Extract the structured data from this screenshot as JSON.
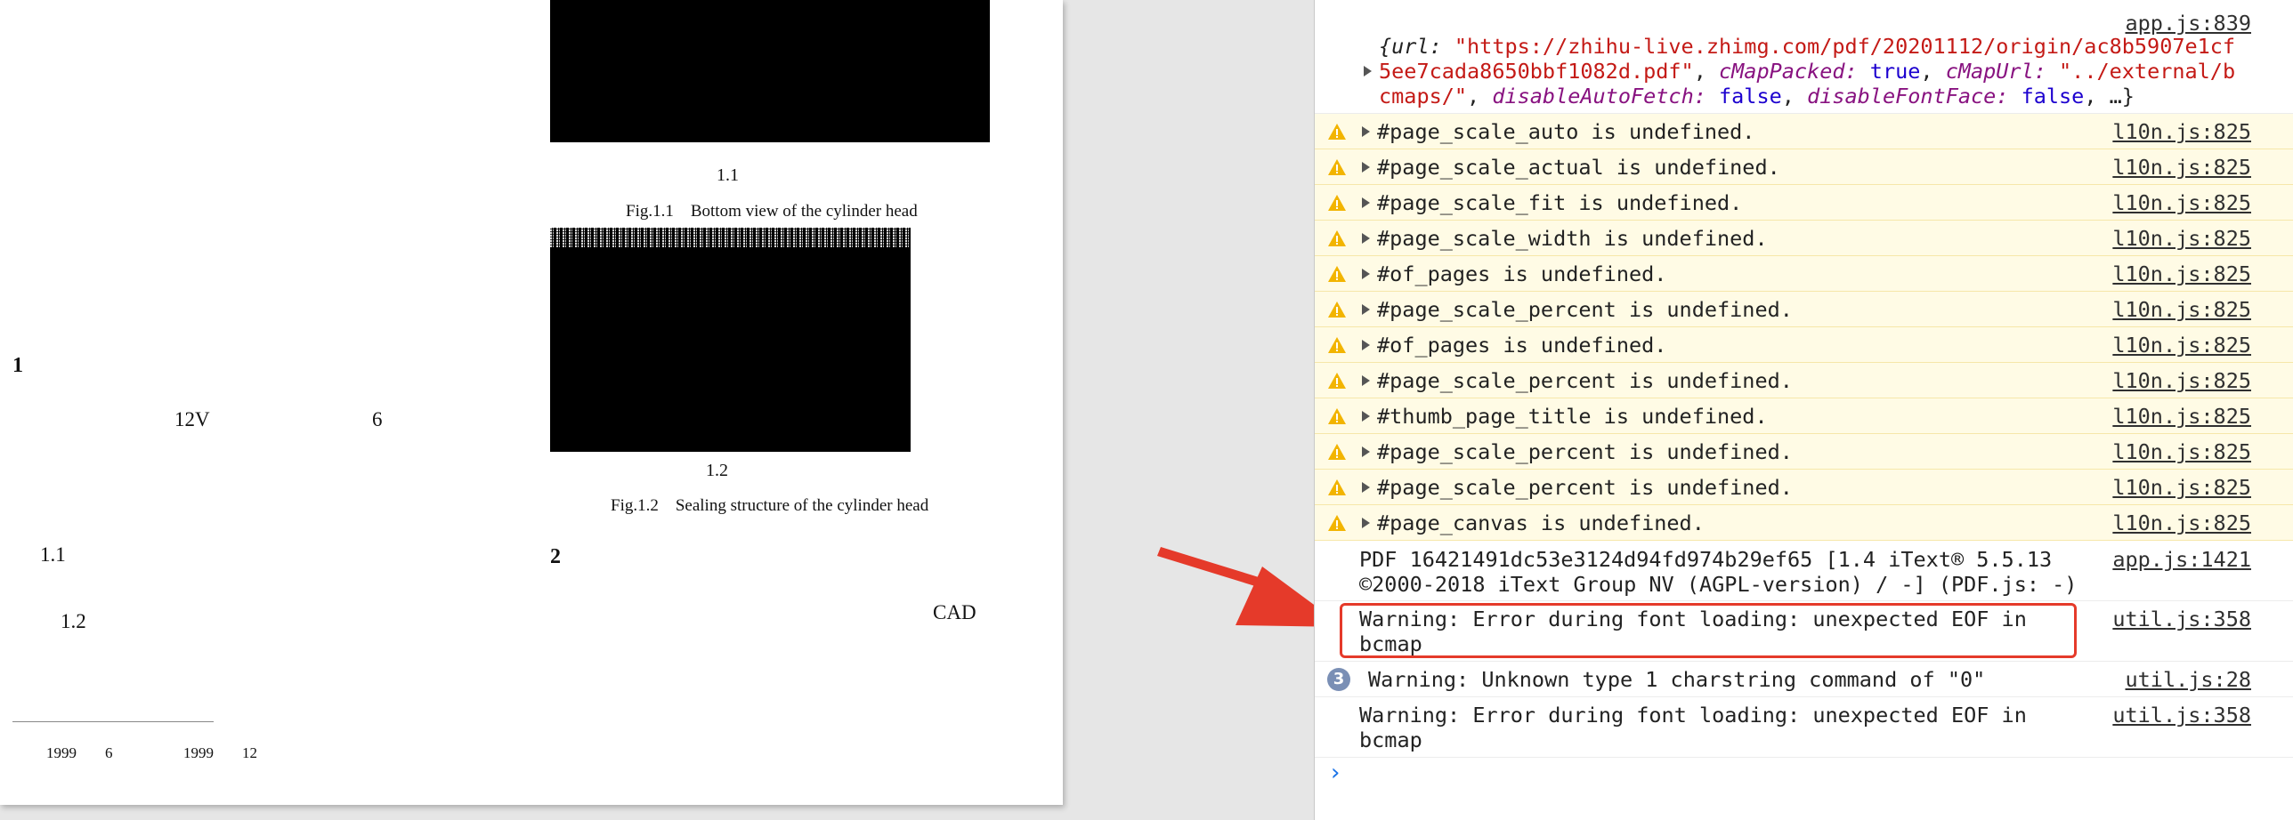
{
  "pdf": {
    "section_number": "1",
    "text_12v": "12V",
    "text_6": "6",
    "text_1_1": "1.1",
    "text_1_2": "1.2",
    "section_number_2": "2",
    "text_cad": "CAD",
    "fig1_number": "1.1",
    "fig1_caption": "Fig.1.1　Bottom view of the cylinder head",
    "fig2_number": "1.2",
    "fig2_caption": "Fig.1.2　Sealing structure of the cylinder head",
    "footnote_year1": "1999",
    "footnote_month1": "6",
    "footnote_year2": "1999",
    "footnote_month2": "12"
  },
  "console": {
    "first_source": "app.js:839",
    "first_line1_prefix": "{url: ",
    "first_line1_url": "\"https://zhihu-live.zhimg.com/pdf/20201112/origin/ac8b5907e1cf",
    "first_line2_url": "5ee7cada8650bbf1082d.pdf\"",
    "first_line2_cmap_key": "cMapPacked: ",
    "first_line2_cmap_val": "true",
    "first_line2_cmapurl_key": "cMapUrl: ",
    "first_line2_cmapurl_val": "\"../external/b",
    "first_line3_val": "cmaps/\"",
    "first_line3_daf_key": "disableAutoFetch: ",
    "first_line3_daf_val": "false",
    "first_line3_dff_key": "disableFontFace: ",
    "first_line3_dff_val": "false",
    "first_line3_tail": ", …}",
    "warnings": [
      {
        "text": "#page_scale_auto is undefined.",
        "source": "l10n.js:825"
      },
      {
        "text": "#page_scale_actual is undefined.",
        "source": "l10n.js:825"
      },
      {
        "text": "#page_scale_fit is undefined.",
        "source": "l10n.js:825"
      },
      {
        "text": "#page_scale_width is undefined.",
        "source": "l10n.js:825"
      },
      {
        "text": "#of_pages is undefined.",
        "source": "l10n.js:825"
      },
      {
        "text": "#page_scale_percent is undefined.",
        "source": "l10n.js:825"
      },
      {
        "text": "#of_pages is undefined.",
        "source": "l10n.js:825"
      },
      {
        "text": "#page_scale_percent is undefined.",
        "source": "l10n.js:825"
      },
      {
        "text": "#thumb_page_title is undefined.",
        "source": "l10n.js:825"
      },
      {
        "text": "#page_scale_percent is undefined.",
        "source": "l10n.js:825"
      },
      {
        "text": "#page_scale_percent is undefined.",
        "source": "l10n.js:825"
      },
      {
        "text": "#page_canvas is undefined.",
        "source": "l10n.js:825"
      }
    ],
    "pdf_info_line1": "PDF 16421491dc53e3124d94fd974b29ef65 [1.4 iText® 5.5.13",
    "pdf_info_line2": "©2000-2018 iText Group NV (AGPL-version) / -] (PDF.js: -)",
    "pdf_info_source": "app.js:1421",
    "font_warning_line1": "Warning: Error during font loading: unexpected EOF in",
    "font_warning_line2": "bcmap",
    "font_warning_source": "util.js:358",
    "repeat_count": "3",
    "charstring_warning": "Warning: Unknown type 1 charstring command of \"0\"",
    "charstring_source": "util.js:28",
    "font_warning2_line1": "Warning: Error during font loading: unexpected EOF in",
    "font_warning2_line2": "bcmap",
    "font_warning2_source": "util.js:358",
    "prompt_symbol": "›"
  },
  "colors": {
    "annotation_red": "#e53a2a",
    "warning_bg": "#fffbe5",
    "warning_icon": "#f2b400",
    "string_red": "#c41a16",
    "keyword_blue": "#1c00cf"
  }
}
